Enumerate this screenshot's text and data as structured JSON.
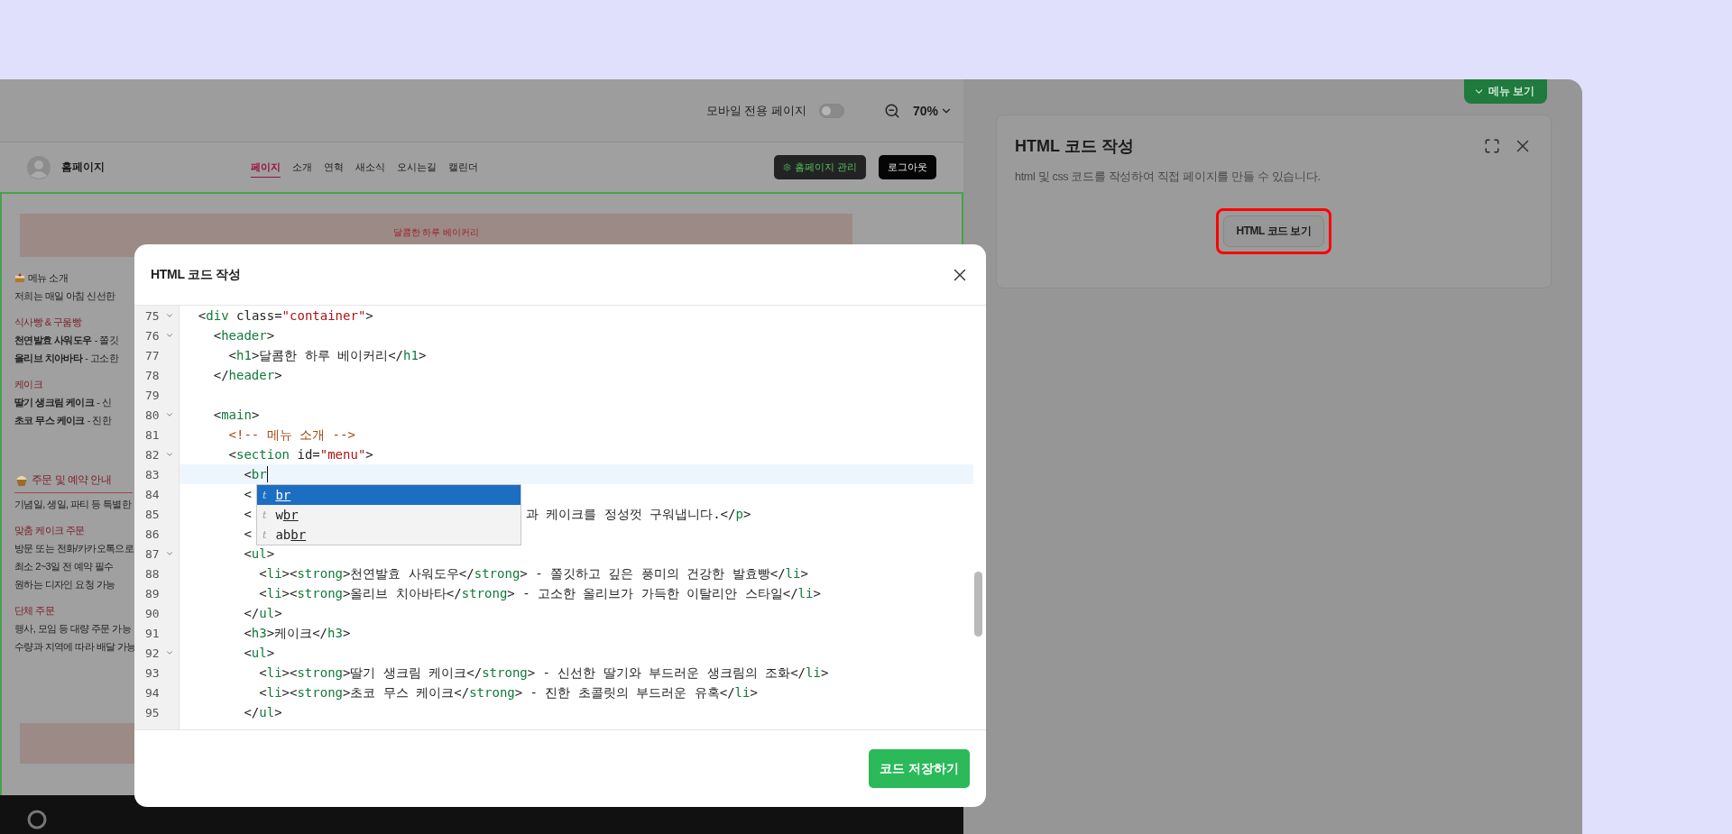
{
  "preview_toolbar": {
    "mobile_label": "모바일 전용 페이지",
    "mobile_on": false,
    "zoom": "70%"
  },
  "site_header": {
    "name": "홈페이지",
    "nav": [
      {
        "label": "페이지",
        "selected": true
      },
      {
        "label": "소개",
        "selected": false
      },
      {
        "label": "연혁",
        "selected": false
      },
      {
        "label": "새소식",
        "selected": false
      },
      {
        "label": "오시는길",
        "selected": false
      },
      {
        "label": "캘린더",
        "selected": false
      }
    ],
    "buttons": [
      {
        "kind": "manage",
        "label": "홈페이지 관리"
      },
      {
        "kind": "logout",
        "label": "로그아웃"
      }
    ]
  },
  "site_content": {
    "banner": "달콤한 하루 베이커리",
    "groups": [
      {
        "items": [
          {
            "kind": "section",
            "text": "메뉴 소개"
          },
          {
            "kind": "line",
            "text": "저희는 매일 아침 신선한"
          }
        ]
      },
      {
        "items": [
          {
            "kind": "heading",
            "text": "식사빵 & 구움빵"
          },
          {
            "kind": "line",
            "text": "**천연발효 사워도우** - 쫄깃"
          },
          {
            "kind": "line",
            "text": "**올리브 치아바타** - 고소한"
          }
        ]
      },
      {
        "items": [
          {
            "kind": "heading",
            "text": "케이크"
          },
          {
            "kind": "line",
            "text": "**딸기 생크림 케이크** - 신"
          },
          {
            "kind": "line",
            "text": "**초코 무스 케이크** - 진한"
          }
        ]
      },
      {
        "items": [
          {
            "kind": "notice",
            "text": "주문 및 예약 안내"
          },
          {
            "kind": "line",
            "text": "기념일, 생일, 파티 등 특별한"
          }
        ]
      },
      {
        "items": [
          {
            "kind": "heading",
            "text": "맞춤 케이크 주문"
          },
          {
            "kind": "line",
            "text": "방문 또는 전화/카카오톡으로"
          },
          {
            "kind": "line",
            "text": "최소 2~3일 전 예약 필수"
          },
          {
            "kind": "line",
            "text": "원하는 디자인 요청 가능"
          }
        ]
      },
      {
        "items": [
          {
            "kind": "heading",
            "text": "단체 주문"
          },
          {
            "kind": "line",
            "text": "행사, 모임 등 대량 주문 가능"
          },
          {
            "kind": "line",
            "text": "수량과 지역에 따라 배달 가능"
          }
        ]
      }
    ]
  },
  "side_panel": {
    "menu_tab": "메뉴 보기",
    "title": "HTML 코드 작성",
    "description": "html 및 css 코드를 작성하여 직접 페이지를 만들 수 있습니다.",
    "button": "HTML 코드 보기",
    "button_highlighted": true
  },
  "modal": {
    "title": "HTML 코드 작성",
    "save_button": "코드 저장하기",
    "lines": [
      {
        "number": "75",
        "fold": true,
        "active": false,
        "segments": [
          {
            "kind": "plain",
            "text": "  <"
          },
          {
            "kind": "tag",
            "text": "div"
          },
          {
            "kind": "plain",
            "text": " class="
          },
          {
            "kind": "string",
            "text": "\"container\""
          },
          {
            "kind": "plain",
            "text": ">"
          }
        ]
      },
      {
        "number": "76",
        "fold": true,
        "active": false,
        "segments": [
          {
            "kind": "plain",
            "text": "    <"
          },
          {
            "kind": "tag",
            "text": "header"
          },
          {
            "kind": "plain",
            "text": ">"
          }
        ]
      },
      {
        "number": "77",
        "fold": false,
        "active": false,
        "segments": [
          {
            "kind": "plain",
            "text": "      <"
          },
          {
            "kind": "tag",
            "text": "h1"
          },
          {
            "kind": "plain",
            "text": ">달콤한 하루 베이커리</"
          },
          {
            "kind": "tag",
            "text": "h1"
          },
          {
            "kind": "plain",
            "text": ">"
          }
        ]
      },
      {
        "number": "78",
        "fold": false,
        "active": false,
        "segments": [
          {
            "kind": "plain",
            "text": "    </"
          },
          {
            "kind": "tag",
            "text": "header"
          },
          {
            "kind": "plain",
            "text": ">"
          }
        ]
      },
      {
        "number": "79",
        "fold": false,
        "active": false
      },
      {
        "number": "80",
        "fold": true,
        "active": false,
        "segments": [
          {
            "kind": "plain",
            "text": "    <"
          },
          {
            "kind": "tag",
            "text": "main"
          },
          {
            "kind": "plain",
            "text": ">"
          }
        ]
      },
      {
        "number": "81",
        "fold": false,
        "active": false,
        "segments": [
          {
            "kind": "comment",
            "text": "      <!-- 메뉴 소개 -->"
          }
        ]
      },
      {
        "number": "82",
        "fold": true,
        "active": false,
        "segments": [
          {
            "kind": "plain",
            "text": "      <"
          },
          {
            "kind": "tag",
            "text": "section"
          },
          {
            "kind": "plain",
            "text": " id="
          },
          {
            "kind": "string",
            "text": "\"menu\""
          },
          {
            "kind": "plain",
            "text": ">"
          }
        ]
      },
      {
        "number": "83",
        "fold": false,
        "active": true,
        "segments": [
          {
            "kind": "plain",
            "text": "        <"
          },
          {
            "kind": "tag",
            "text": "br"
          }
        ]
      },
      {
        "number": "84",
        "fold": false,
        "active": false,
        "segments": [
          {
            "kind": "plain",
            "text": "        <"
          }
        ]
      },
      {
        "number": "85",
        "fold": false,
        "active": false,
        "segments": [
          {
            "kind": "plain",
            "text": "        <"
          }
        ],
        "tail": [
          {
            "kind": "plain",
            "text": "과 케이크를 정성껏 구워냅니다.</"
          },
          {
            "kind": "tag",
            "text": "p"
          },
          {
            "kind": "plain",
            "text": ">"
          }
        ]
      },
      {
        "number": "86",
        "fold": false,
        "active": false,
        "segments": [
          {
            "kind": "plain",
            "text": "        <"
          }
        ]
      },
      {
        "number": "87",
        "fold": true,
        "active": false,
        "segments": [
          {
            "kind": "plain",
            "text": "        <"
          },
          {
            "kind": "tag",
            "text": "ul"
          },
          {
            "kind": "plain",
            "text": ">"
          }
        ]
      },
      {
        "number": "88",
        "fold": false,
        "active": false,
        "segments": [
          {
            "kind": "plain",
            "text": "          <"
          },
          {
            "kind": "tag",
            "text": "li"
          },
          {
            "kind": "plain",
            "text": "><"
          },
          {
            "kind": "tag",
            "text": "strong"
          },
          {
            "kind": "plain",
            "text": ">천연발효 사워도우</"
          },
          {
            "kind": "tag",
            "text": "strong"
          },
          {
            "kind": "plain",
            "text": "> - 쫄깃하고 깊은 풍미의 건강한 발효빵</"
          },
          {
            "kind": "tag",
            "text": "li"
          },
          {
            "kind": "plain",
            "text": ">"
          }
        ]
      },
      {
        "number": "89",
        "fold": false,
        "active": false,
        "segments": [
          {
            "kind": "plain",
            "text": "          <"
          },
          {
            "kind": "tag",
            "text": "li"
          },
          {
            "kind": "plain",
            "text": "><"
          },
          {
            "kind": "tag",
            "text": "strong"
          },
          {
            "kind": "plain",
            "text": ">올리브 치아바타</"
          },
          {
            "kind": "tag",
            "text": "strong"
          },
          {
            "kind": "plain",
            "text": "> - 고소한 올리브가 가득한 이탈리안 스타일</"
          },
          {
            "kind": "tag",
            "text": "li"
          },
          {
            "kind": "plain",
            "text": ">"
          }
        ]
      },
      {
        "number": "90",
        "fold": false,
        "active": false,
        "segments": [
          {
            "kind": "plain",
            "text": "        </"
          },
          {
            "kind": "tag",
            "text": "ul"
          },
          {
            "kind": "plain",
            "text": ">"
          }
        ]
      },
      {
        "number": "91",
        "fold": false,
        "active": false,
        "segments": [
          {
            "kind": "plain",
            "text": "        <"
          },
          {
            "kind": "tag",
            "text": "h3"
          },
          {
            "kind": "plain",
            "text": ">케이크</"
          },
          {
            "kind": "tag",
            "text": "h3"
          },
          {
            "kind": "plain",
            "text": ">"
          }
        ]
      },
      {
        "number": "92",
        "fold": true,
        "active": false,
        "segments": [
          {
            "kind": "plain",
            "text": "        <"
          },
          {
            "kind": "tag",
            "text": "ul"
          },
          {
            "kind": "plain",
            "text": ">"
          }
        ]
      },
      {
        "number": "93",
        "fold": false,
        "active": false,
        "segments": [
          {
            "kind": "plain",
            "text": "          <"
          },
          {
            "kind": "tag",
            "text": "li"
          },
          {
            "kind": "plain",
            "text": "><"
          },
          {
            "kind": "tag",
            "text": "strong"
          },
          {
            "kind": "plain",
            "text": ">딸기 생크림 케이크</"
          },
          {
            "kind": "tag",
            "text": "strong"
          },
          {
            "kind": "plain",
            "text": "> - 신선한 딸기와 부드러운 생크림의 조화</"
          },
          {
            "kind": "tag",
            "text": "li"
          },
          {
            "kind": "plain",
            "text": ">"
          }
        ]
      },
      {
        "number": "94",
        "fold": false,
        "active": false,
        "segments": [
          {
            "kind": "plain",
            "text": "          <"
          },
          {
            "kind": "tag",
            "text": "li"
          },
          {
            "kind": "plain",
            "text": "><"
          },
          {
            "kind": "tag",
            "text": "strong"
          },
          {
            "kind": "plain",
            "text": ">초코 무스 케이크</"
          },
          {
            "kind": "tag",
            "text": "strong"
          },
          {
            "kind": "plain",
            "text": "> - 진한 초콜릿의 부드러운 유혹</"
          },
          {
            "kind": "tag",
            "text": "li"
          },
          {
            "kind": "plain",
            "text": ">"
          }
        ]
      },
      {
        "number": "95",
        "fold": false,
        "active": false,
        "segments": [
          {
            "kind": "plain",
            "text": "        </"
          },
          {
            "kind": "tag",
            "text": "ul"
          },
          {
            "kind": "plain",
            "text": ">"
          }
        ]
      }
    ],
    "suggestions": [
      {
        "type": "t",
        "match": "br",
        "selected": true
      },
      {
        "type": "t",
        "before": "w",
        "match": "br",
        "selected": false
      },
      {
        "type": "t",
        "before": "ab",
        "match": "br",
        "selected": false
      }
    ]
  }
}
